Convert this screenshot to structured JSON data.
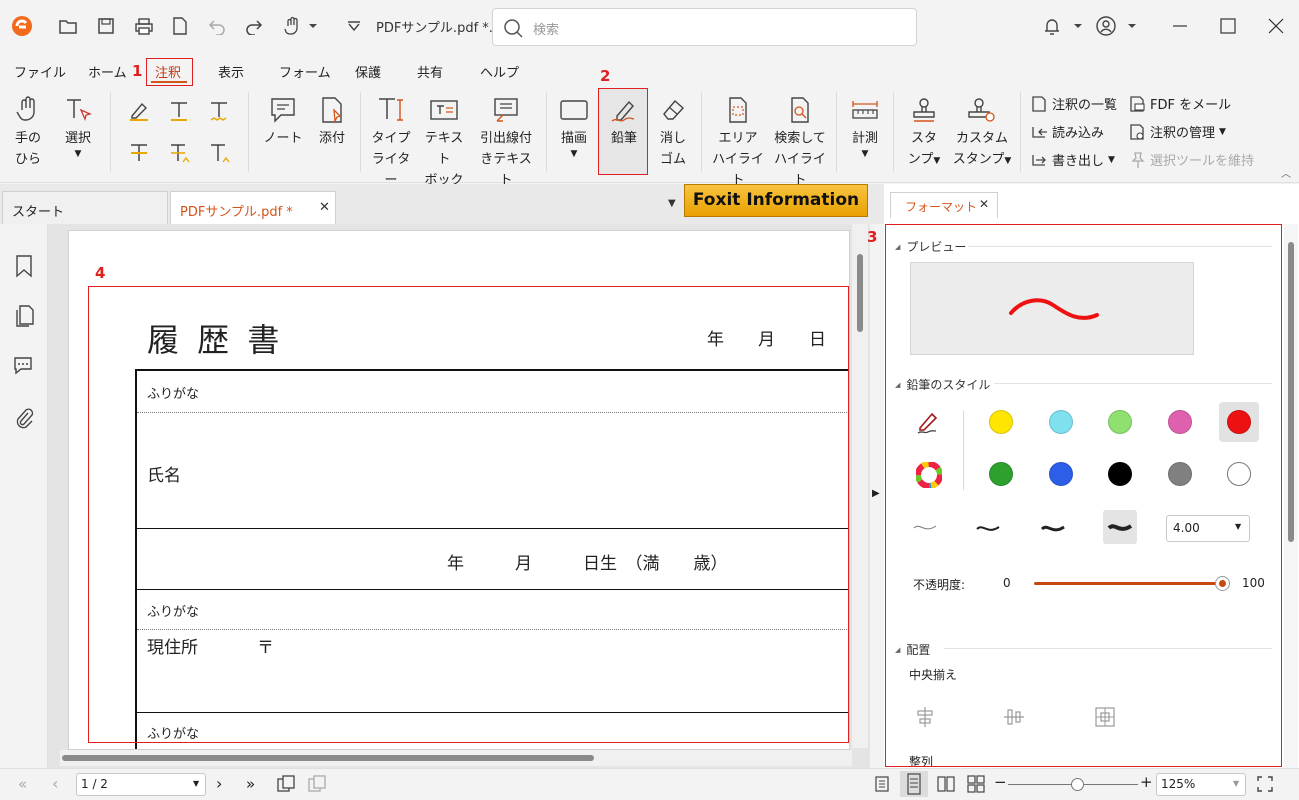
{
  "app": {
    "title": "PDFサンプル.pdf *...",
    "search_placeholder": "検索"
  },
  "menu": [
    "ファイル",
    "ホーム",
    "注釈",
    "表示",
    "フォーム",
    "保護",
    "共有",
    "ヘルプ"
  ],
  "annotations": {
    "n1": "1",
    "n2": "2",
    "n3": "3",
    "n4": "4"
  },
  "ribbon": {
    "hand_l1": "手の",
    "hand_l2": "ひら",
    "select": "選択",
    "note": "ノート",
    "attach": "添付",
    "type_l1": "タイプ",
    "type_l2": "ライター",
    "textbox_l1": "テキスト",
    "textbox_l2": "ボックス",
    "callout_l1": "引出線付",
    "callout_l2": "きテキスト",
    "draw": "描画",
    "pencil": "鉛筆",
    "eraser_l1": "消し",
    "eraser_l2": "ゴム",
    "area_l1": "エリア",
    "area_l2": "ハイライト",
    "searchhl_l1": "検索して",
    "searchhl_l2": "ハイライト",
    "measure": "計測",
    "stamp_l1": "スタ",
    "stamp_l2": "ンプ",
    "cstamp_l1": "カスタム",
    "cstamp_l2": "スタンプ",
    "list": "注釈の一覧",
    "import": "読み込み",
    "export": "書き出し",
    "fdf": "FDF をメール",
    "manage": "注釈の管理",
    "keep": "選択ツールを維持"
  },
  "tabs": {
    "start": "スタート",
    "doc": "PDFサンプル.pdf *",
    "banner": "Foxit Information",
    "format": "フォーマット"
  },
  "doc": {
    "title": "履 歴 書",
    "date": "年　　月　　日",
    "furigana1": "ふりがな",
    "name": "氏名",
    "birth": "年　　　月　　　日生　（満　　歳）",
    "furigana2": "ふりがな",
    "address": "現住所",
    "postal": "〒",
    "furigana3": "ふりがな"
  },
  "format_panel": {
    "preview": "プレビュー",
    "style": "鉛筆のスタイル",
    "thickness": "4.00",
    "opacity_label": "不透明度:",
    "opacity_min": "0",
    "opacity_max": "100",
    "opacity": 1.0,
    "placement": "配置",
    "center": "中央揃え",
    "align": "整列",
    "colors": [
      "#ffe600",
      "#7fe0f0",
      "#90e070",
      "#e060b0",
      "#ee1111",
      "#2ea02e",
      "#2d5ee8",
      "#000000",
      "#808080",
      "#ffffff"
    ],
    "selected_color": "#ee1111"
  },
  "status": {
    "page": "1 / 2",
    "zoom": "125%"
  }
}
